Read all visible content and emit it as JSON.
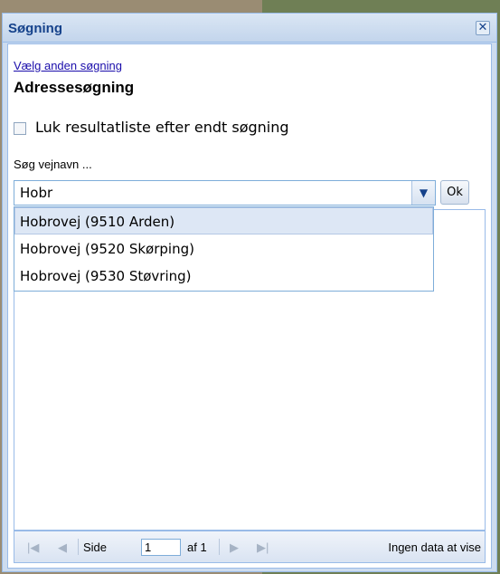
{
  "window": {
    "title": "Søgning",
    "close_icon": "close-icon"
  },
  "search": {
    "change_search_link": "Vælg anden søgning",
    "heading": "Adressesøgning",
    "close_results_checkbox_label": "Luk resultatliste efter endt søgning",
    "close_results_checked": false,
    "field_label": "Søg vejnavn ...",
    "input_value": "Hobr",
    "ok_label": "Ok",
    "suggestions": [
      "Hobrovej (9510 Arden)",
      "Hobrovej (9520 Skørping)",
      "Hobrovej (9530 Støvring)"
    ]
  },
  "paging": {
    "page_label": "Side",
    "page_value": "1",
    "of_label": "af 1",
    "status": "Ingen data at vise"
  },
  "colors": {
    "header_text": "#15428b",
    "panel_border": "#99bbe8",
    "link": "#1a0dab"
  }
}
